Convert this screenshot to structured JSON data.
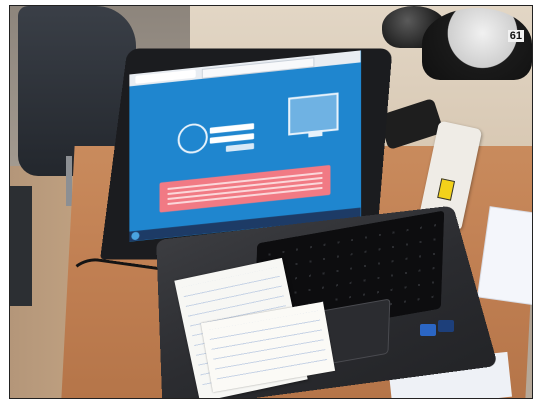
{
  "scene": {
    "subject": "laptop-on-desk",
    "helmet_label": "61"
  },
  "screen": {
    "background_color": "#1f86cf",
    "alert_color": "#f17a84"
  },
  "icons": [
    "login-icon",
    "monitor-icon",
    "windows-start-icon"
  ]
}
